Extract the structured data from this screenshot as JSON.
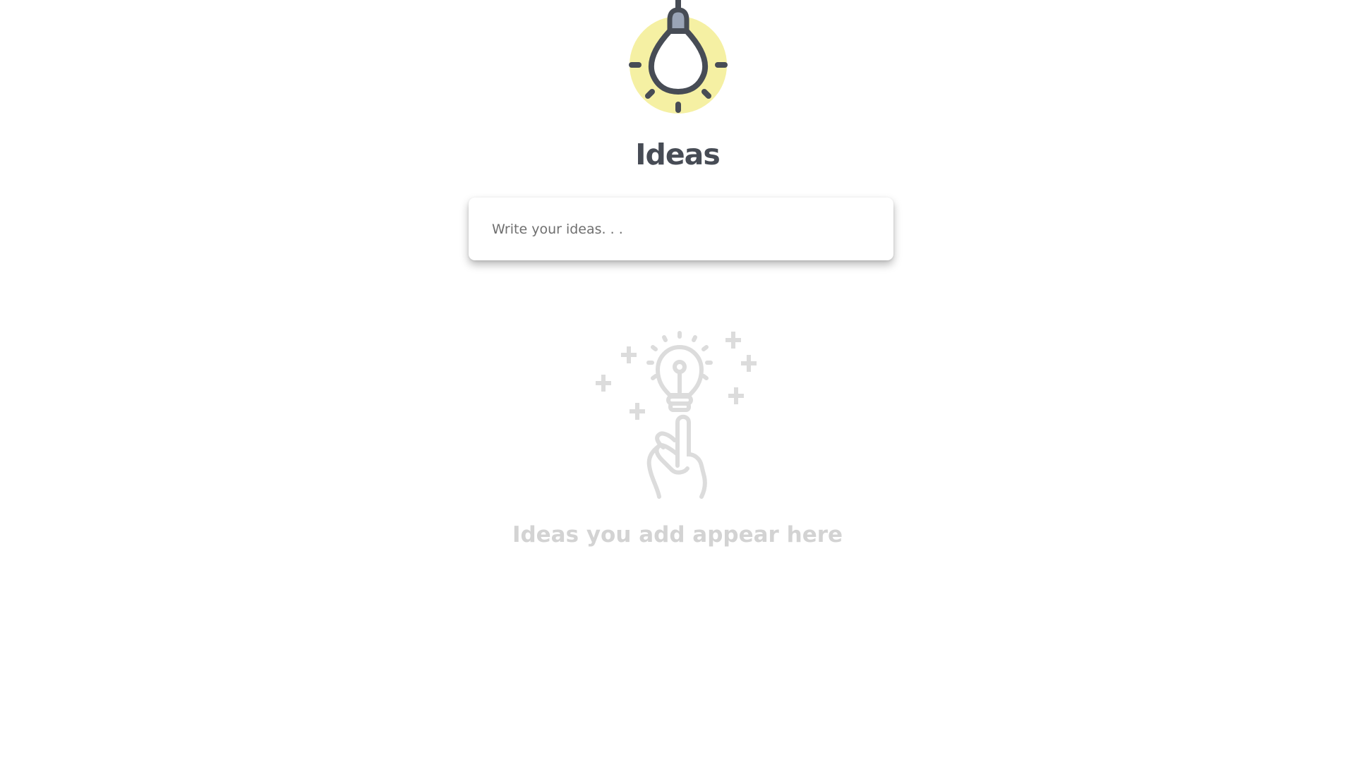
{
  "app": {
    "title": "Ideas",
    "logo_icon": "lightbulb-icon",
    "colors": {
      "logo_circle": "#f5f0a3",
      "logo_stroke": "#474c55",
      "logo_socket": "#9aa4b6",
      "empty_state": "#d3d3d3"
    }
  },
  "input": {
    "placeholder": "Write your ideas. . ."
  },
  "empty_state": {
    "icon": "idea-hand-icon",
    "message": "Ideas you add appear here"
  }
}
